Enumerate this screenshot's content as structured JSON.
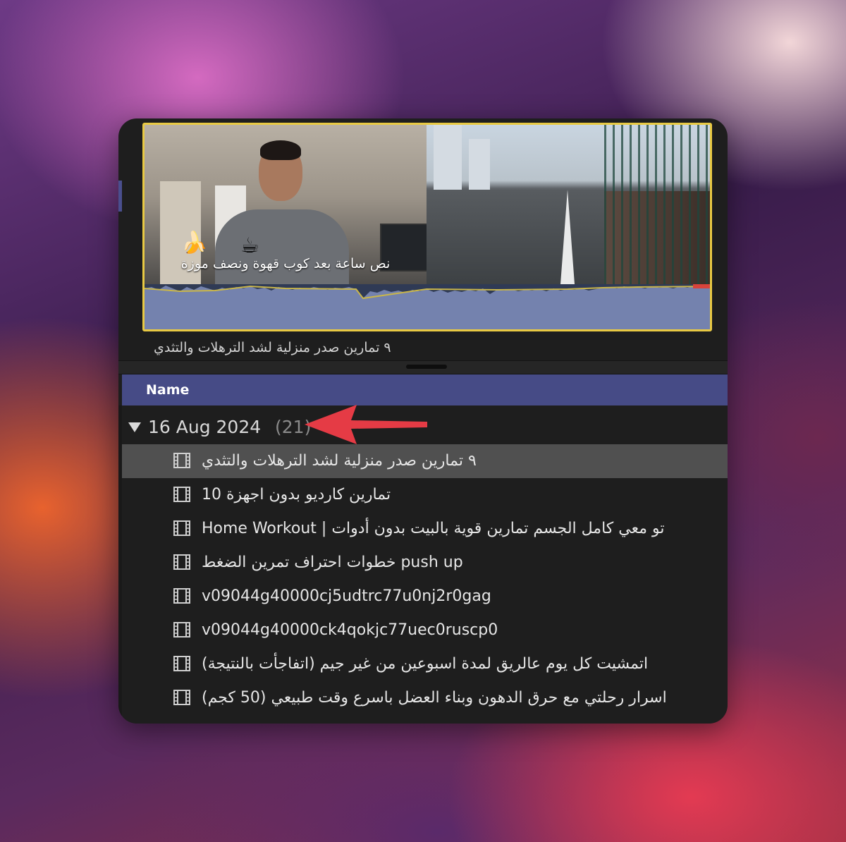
{
  "preview": {
    "caption": "نص ساعة بعد كوب قهوة ونصف موزة",
    "emoji_banana": "🍌",
    "emoji_coffee": "☕",
    "clip_title": "٩ تمارين صدر منزلية لشد الترهلات والتثدي",
    "accent_color": "#e8c943"
  },
  "browser": {
    "column_header": "Name",
    "header_color": "#464b86",
    "group": {
      "date": "16 Aug 2024",
      "count": "(21)",
      "expanded": true
    },
    "annotation_arrow_color": "#e53b45",
    "items": [
      {
        "label": "٩ تمارين صدر منزلية لشد الترهلات والتثدي",
        "icon": "film-icon",
        "selected": true
      },
      {
        "label": "10 تمارين كارديو بدون اجهزة",
        "icon": "film-icon",
        "selected": false
      },
      {
        "label": "Home Workout | تو معي كامل الجسم تمارين قوية بالبيت بدون أدوات",
        "icon": "film-icon",
        "selected": false
      },
      {
        "label": "خطوات احتراف تمرين الضغط push up",
        "icon": "film-icon",
        "selected": false
      },
      {
        "label": "v09044g40000cj5udtrc77u0nj2r0gag",
        "icon": "film-icon",
        "selected": false
      },
      {
        "label": "v09044g40000ck4qokjc77uec0ruscp0",
        "icon": "film-icon",
        "selected": false
      },
      {
        "label": "اتمشيت كل يوم عالريق لمدة اسبوعين من غير جيم (اتفاجأت بالنتيجة)",
        "icon": "film-icon",
        "selected": false
      },
      {
        "label": "اسرار رحلتي مع حرق الدهون وبناء العضل باسرع وقت طبيعي (50 كجم)",
        "icon": "film-icon",
        "selected": false
      }
    ]
  }
}
